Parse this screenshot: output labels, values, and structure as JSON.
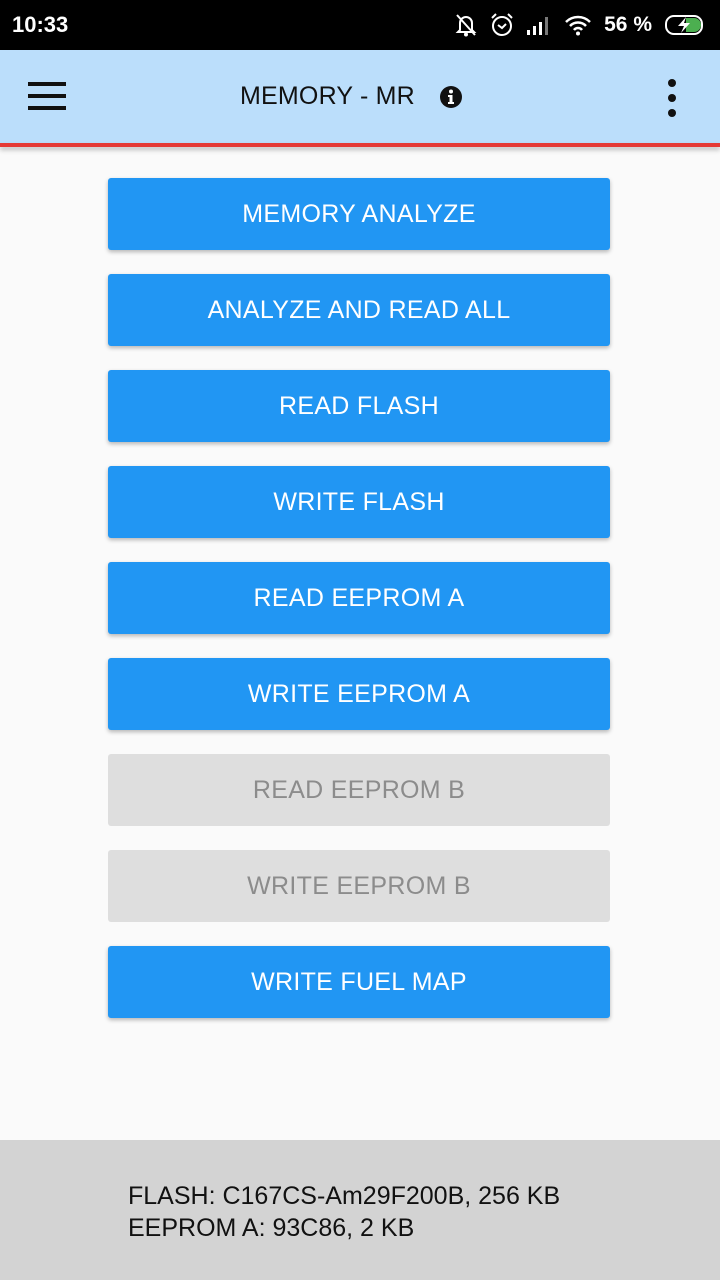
{
  "status_bar": {
    "time": "10:33",
    "icons": [
      "notifications-off-icon",
      "alarm-icon",
      "signal-icon",
      "wifi-icon"
    ],
    "battery_percent_label": "56 %",
    "battery_level": 56,
    "battery_charging": true
  },
  "app_bar": {
    "menu_icon": "hamburger-menu-icon",
    "title": "MEMORY - MR",
    "info_icon": "info-icon",
    "overflow_icon": "more-vert-icon",
    "accent_line_color": "#e53935",
    "background_color": "#bbdefb"
  },
  "actions": [
    {
      "label": "MEMORY ANALYZE",
      "enabled": true
    },
    {
      "label": "ANALYZE AND READ ALL",
      "enabled": true
    },
    {
      "label": "READ FLASH",
      "enabled": true
    },
    {
      "label": "WRITE FLASH",
      "enabled": true
    },
    {
      "label": "READ EEPROM A",
      "enabled": true
    },
    {
      "label": "WRITE EEPROM A",
      "enabled": true
    },
    {
      "label": "READ EEPROM B",
      "enabled": false
    },
    {
      "label": "WRITE EEPROM B",
      "enabled": false
    },
    {
      "label": "WRITE FUEL MAP",
      "enabled": true
    }
  ],
  "colors": {
    "primary_button": "#2196f3",
    "disabled_button": "#dedede",
    "disabled_text": "#8c8c8c"
  },
  "footer": {
    "flash_info": "FLASH: C167CS-Am29F200B, 256 KB",
    "eeprom_a_info": "EEPROM A: 93C86, 2 KB"
  }
}
